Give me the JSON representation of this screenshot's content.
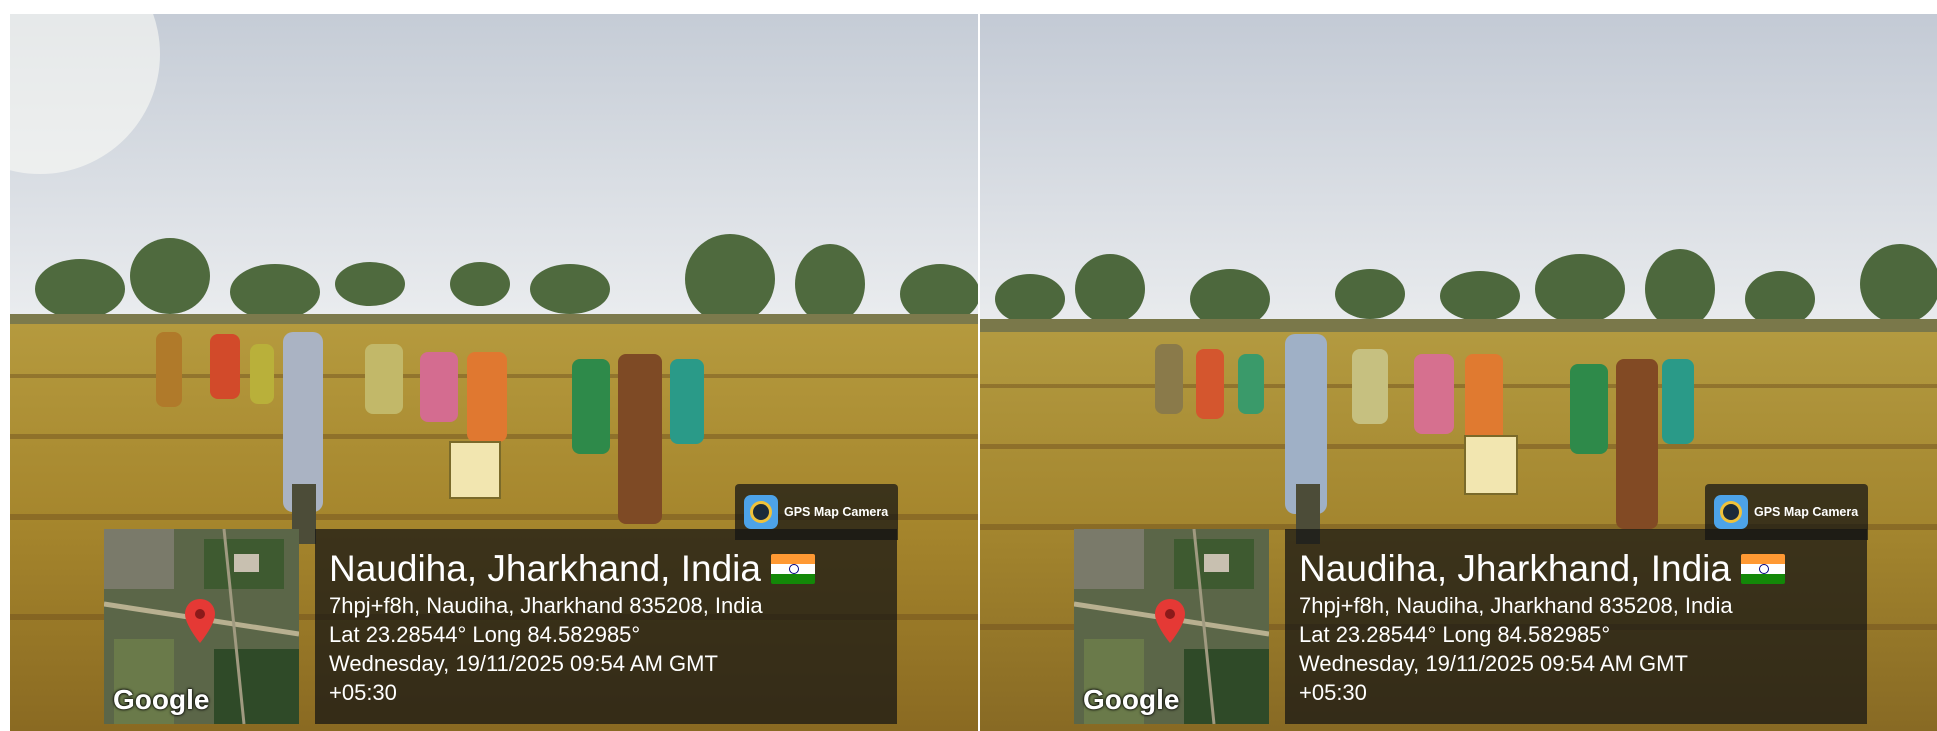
{
  "panels": [
    {
      "id": "left",
      "gps_camera_label": "GPS Map Camera",
      "map_brand": "Google",
      "location_title": "Naudiha, Jharkhand, India",
      "address": "7hpj+f8h, Naudiha, Jharkhand 835208, India",
      "coordinates": "Lat 23.28544° Long 84.582985°",
      "datetime": "Wednesday, 19/11/2025 09:54 AM GMT",
      "timezone": "+05:30"
    },
    {
      "id": "right",
      "gps_camera_label": "GPS Map Camera",
      "map_brand": "Google",
      "location_title": "Naudiha, Jharkhand, India",
      "address": "7hpj+f8h, Naudiha, Jharkhand 835208, India",
      "coordinates": "Lat 23.28544° Long 84.582985°",
      "datetime": "Wednesday, 19/11/2025 09:54 AM GMT",
      "timezone": "+05:30"
    }
  ],
  "colors": {
    "sky_top": "#c9cfd8",
    "sky_bottom": "#eef0f2",
    "crop_field": "#a8862a",
    "pin_red": "#e53935"
  },
  "icons": {
    "gps_camera": "gps-map-camera-icon",
    "map_marker": "map-pin-icon",
    "flag": "india-flag-icon"
  }
}
